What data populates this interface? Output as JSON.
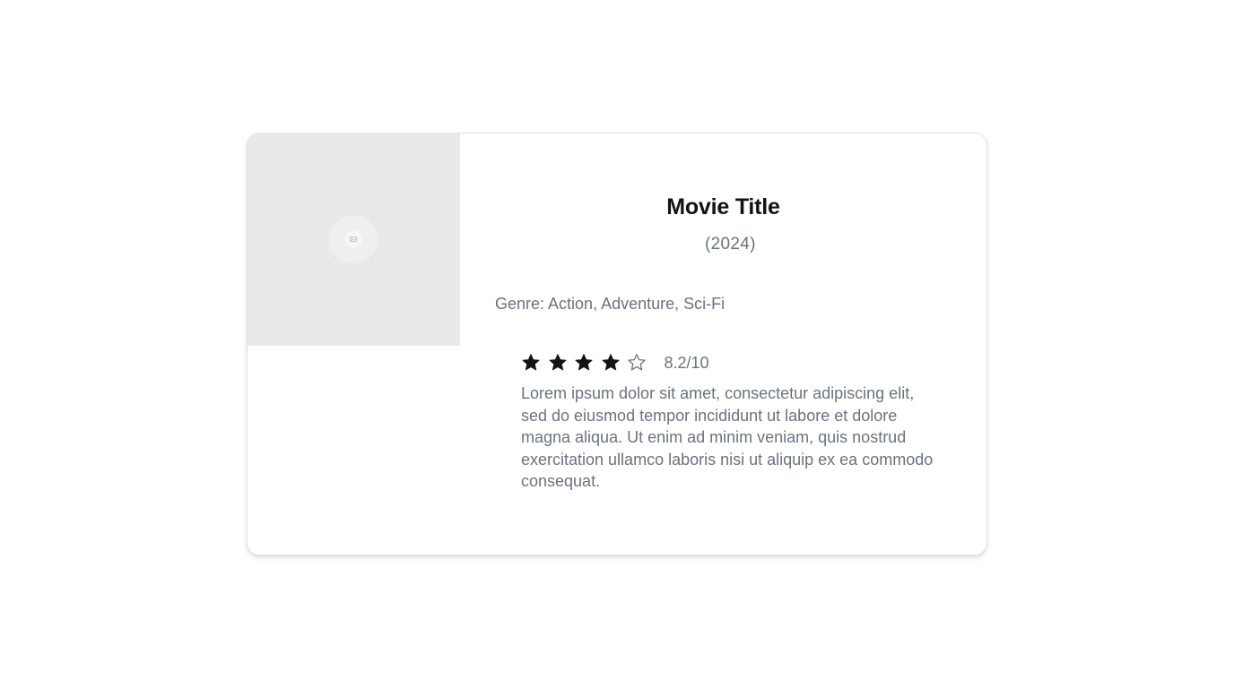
{
  "movie": {
    "title": "Movie Title",
    "year": "(2024)",
    "genre": "Genre: Action, Adventure, Sci-Fi",
    "rating": {
      "stars_filled": 4,
      "stars_total": 5,
      "score_text": "8.2/10"
    },
    "description": "Lorem ipsum dolor sit amet, consectetur adipiscing elit, sed do eiusmod tempor incididunt ut labore et dolore magna aliqua. Ut enim ad minim veniam, quis nostrud exercitation ullamco laboris nisi ut aliquip ex ea commodo consequat."
  },
  "poster": {
    "icon": "image-placeholder-icon"
  },
  "colors": {
    "star_filled": "#111317",
    "star_empty_stroke": "#6b7280",
    "muted_text": "#6b7280",
    "title_text": "#111317",
    "poster_bg": "#e9e9e9"
  }
}
